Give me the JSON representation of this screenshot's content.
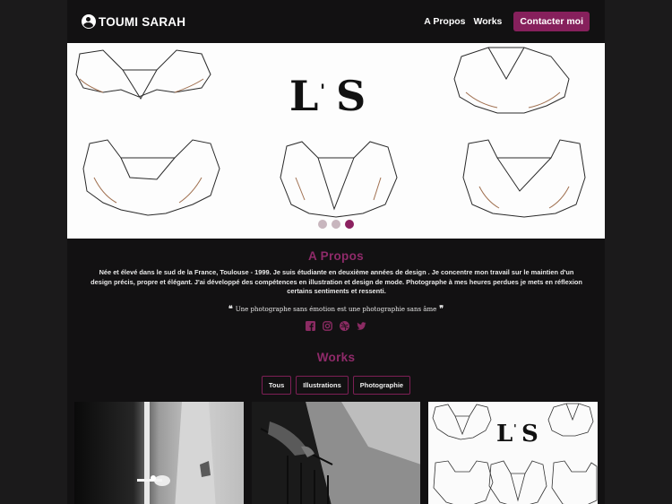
{
  "navbar": {
    "brand": "TOUMI SARAH",
    "links": [
      "A Propos",
      "Works"
    ],
    "cta": "Contacter moi"
  },
  "carousel": {
    "slide_logo": "LS",
    "slide_count": 3,
    "active_index": 2
  },
  "about": {
    "title": "A Propos",
    "text": "Née et élevé dans le sud de la France, Toulouse - 1999. Je suis étudiante en deuxième années de design . Je concentre mon travail sur le maintien d'un design précis, propre et élégant. J'ai développé des compétences en illustration et design de mode. Photographe à mes heures perdues je mets en réflexion certains sentiments et ressenti.",
    "quote": "Une photographe sans émotion est une photographie sans âme",
    "quote_open": "❝",
    "quote_close": "❞",
    "socials": [
      "facebook-icon",
      "instagram-icon",
      "dribbble-icon",
      "twitter-icon"
    ]
  },
  "works": {
    "title": "Works",
    "filters": [
      "Tous",
      "Illustrations",
      "Photographie"
    ],
    "thumb_logo": "LS"
  },
  "colors": {
    "accent": "#86205c",
    "title": "#8f2a69",
    "background": "#121112"
  }
}
